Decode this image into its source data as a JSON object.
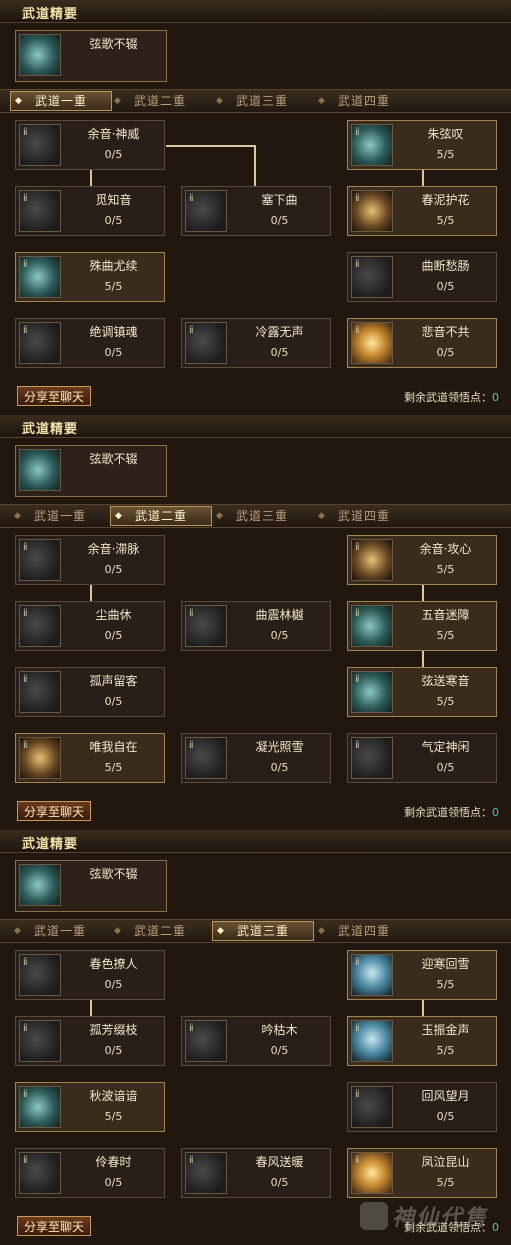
{
  "panels": [
    {
      "header": "武道精要",
      "essence": {
        "name": "弦歌不辍"
      },
      "tabs": [
        "武道一重",
        "武道二重",
        "武道三重",
        "武道四重"
      ],
      "active_tab": 0,
      "cards": [
        {
          "name": "余音·神威",
          "value": "0/5",
          "icon": "dim",
          "lit": false
        },
        {
          "name": "朱弦叹",
          "value": "5/5",
          "icon": "teal",
          "lit": true
        },
        {
          "name": "觅知音",
          "value": "0/5",
          "icon": "dim",
          "lit": false
        },
        {
          "name": "塞下曲",
          "value": "0/5",
          "icon": "dim",
          "lit": false
        },
        {
          "name": "春泥护花",
          "value": "5/5",
          "icon": "warm",
          "lit": true
        },
        {
          "name": "殊曲尤续",
          "value": "5/5",
          "icon": "teal",
          "lit": true
        },
        {
          "name": "曲断愁肠",
          "value": "0/5",
          "icon": "dim",
          "lit": false
        },
        {
          "name": "绝调镇魂",
          "value": "0/5",
          "icon": "dim",
          "lit": false
        },
        {
          "name": "冷露无声",
          "value": "0/5",
          "icon": "dim",
          "lit": false
        },
        {
          "name": "悲音不共",
          "value": "0/5",
          "icon": "gold",
          "lit": true
        }
      ],
      "share_label": "分享至聊天",
      "points_label": "剩余武道领悟点：",
      "points_value": "0"
    },
    {
      "header": "武道精要",
      "essence": {
        "name": "弦歌不辍"
      },
      "tabs": [
        "武道一重",
        "武道二重",
        "武道三重",
        "武道四重"
      ],
      "active_tab": 1,
      "cards": [
        {
          "name": "余音·滞脉",
          "value": "0/5",
          "icon": "dim",
          "lit": false
        },
        {
          "name": "余音·攻心",
          "value": "5/5",
          "icon": "warm",
          "lit": true
        },
        {
          "name": "尘曲休",
          "value": "0/5",
          "icon": "dim",
          "lit": false
        },
        {
          "name": "曲震林樾",
          "value": "0/5",
          "icon": "dim",
          "lit": false
        },
        {
          "name": "五音迷障",
          "value": "5/5",
          "icon": "teal",
          "lit": true
        },
        {
          "name": "孤声留客",
          "value": "0/5",
          "icon": "dim",
          "lit": false
        },
        {
          "name": "弦送寒音",
          "value": "5/5",
          "icon": "teal",
          "lit": true
        },
        {
          "name": "唯我自在",
          "value": "5/5",
          "icon": "warm",
          "lit": true
        },
        {
          "name": "凝光照雪",
          "value": "0/5",
          "icon": "dim",
          "lit": false
        },
        {
          "name": "气定神闲",
          "value": "0/5",
          "icon": "dim",
          "lit": false
        }
      ],
      "share_label": "分享至聊天",
      "points_label": "剩余武道领悟点：",
      "points_value": "0"
    },
    {
      "header": "武道精要",
      "essence": {
        "name": "弦歌不辍"
      },
      "tabs": [
        "武道一重",
        "武道二重",
        "武道三重",
        "武道四重"
      ],
      "active_tab": 2,
      "cards": [
        {
          "name": "春色撩人",
          "value": "0/5",
          "icon": "dim",
          "lit": false
        },
        {
          "name": "迎寒回雪",
          "value": "5/5",
          "icon": "blue",
          "lit": true
        },
        {
          "name": "孤芳缀枝",
          "value": "0/5",
          "icon": "dim",
          "lit": false
        },
        {
          "name": "吟枯木",
          "value": "0/5",
          "icon": "dim",
          "lit": false
        },
        {
          "name": "玉振金声",
          "value": "5/5",
          "icon": "blue",
          "lit": true
        },
        {
          "name": "秋波谙谙",
          "value": "5/5",
          "icon": "teal",
          "lit": true
        },
        {
          "name": "回风望月",
          "value": "0/5",
          "icon": "dim",
          "lit": false
        },
        {
          "name": "伶春时",
          "value": "0/5",
          "icon": "dim",
          "lit": false
        },
        {
          "name": "春风送暖",
          "value": "0/5",
          "icon": "dim",
          "lit": false
        },
        {
          "name": "凤泣昆山",
          "value": "5/5",
          "icon": "gold",
          "lit": true
        }
      ],
      "share_label": "分享至聊天",
      "points_label": "剩余武道领悟点：",
      "points_value": "0"
    }
  ],
  "watermark": "神仙代售"
}
